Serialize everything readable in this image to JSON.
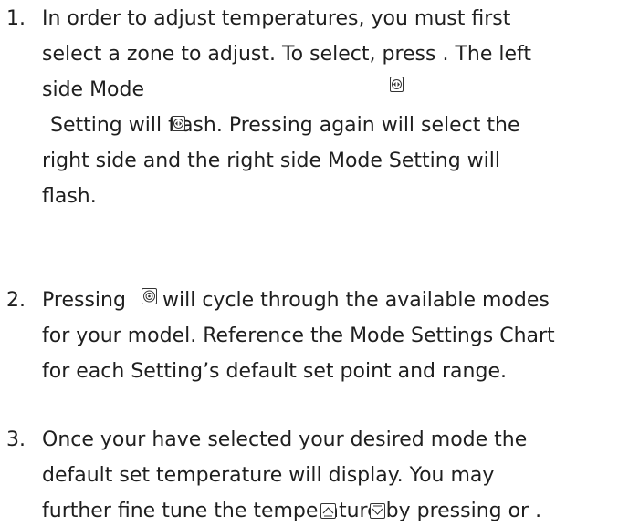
{
  "steps": [
    {
      "number": "1.",
      "lines": [
        "In order to adjust temperatures, you must first",
        "select a zone to adjust. To select, press . The left",
        "side Mode",
        "Setting will flash. Pressing again will select the",
        "right side and the right side Mode Setting will",
        "flash."
      ]
    },
    {
      "number": "2.",
      "lines": [
        "Pressing",
        "will cycle through the available modes",
        "for your model. Reference the Mode Settings Chart",
        "for each Setting’s default set point and range."
      ]
    },
    {
      "number": "3.",
      "lines": [
        "Once your have selected your desired mode the",
        "default set temperature will display. You may",
        "further fine tune the temperature by pressing or ."
      ]
    }
  ],
  "icons": {
    "zone_select": "zone-select-icon",
    "zone_select_inline": "zone-select-icon",
    "mode": "mode-icon",
    "temp_up": "temperature-up-icon",
    "temp_down": "temperature-down-icon"
  }
}
